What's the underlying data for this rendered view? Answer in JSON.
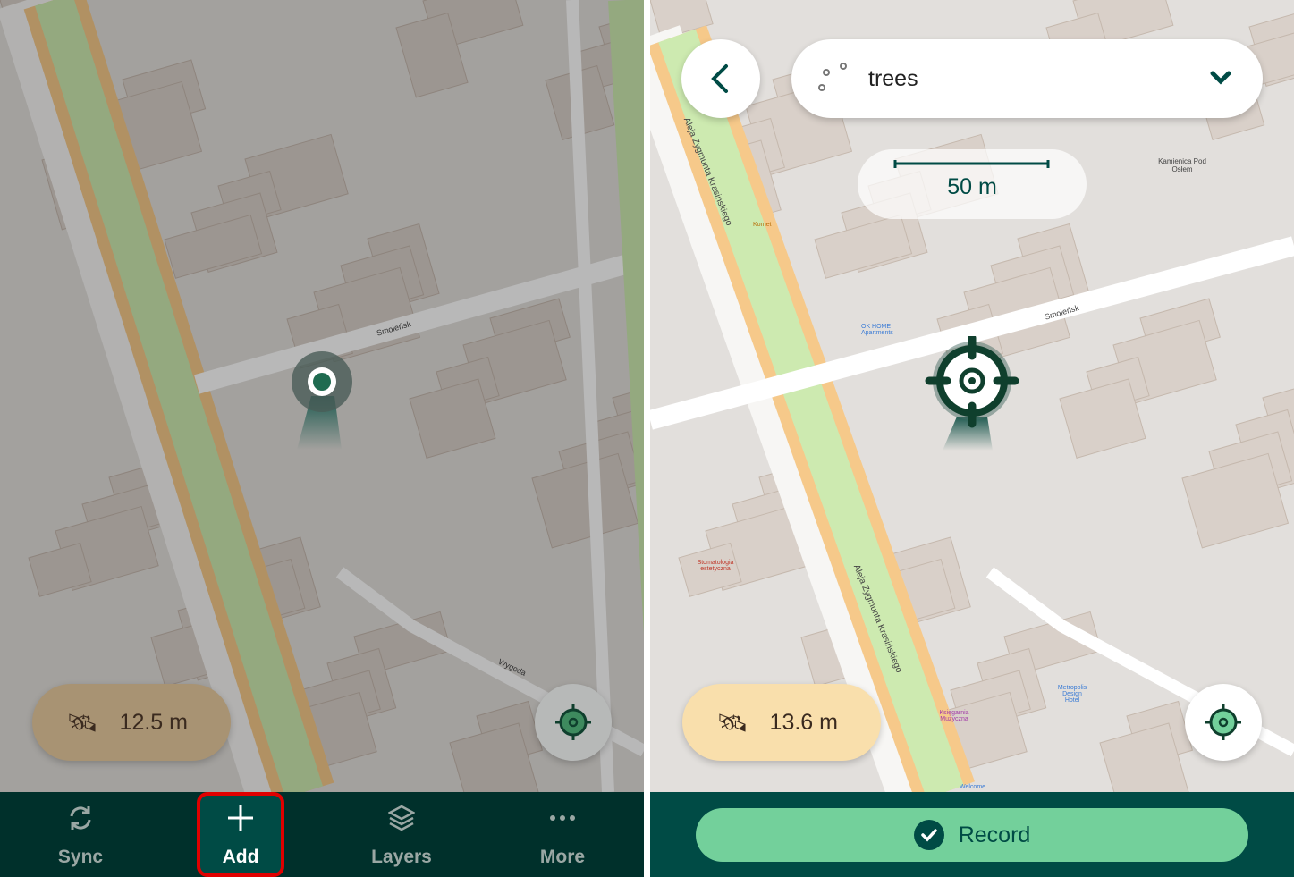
{
  "left": {
    "gps_accuracy": "12.5 m",
    "nav": [
      {
        "label": "Sync",
        "icon": "sync-icon"
      },
      {
        "label": "Add",
        "icon": "plus-icon",
        "highlighted": true
      },
      {
        "label": "Layers",
        "icon": "layers-icon"
      },
      {
        "label": "More",
        "icon": "more-icon"
      }
    ]
  },
  "right": {
    "layer_selector": {
      "value": "trees",
      "icon": "point-layer-icon"
    },
    "scale_bar": "50 m",
    "gps_accuracy": "13.6 m",
    "record_label": "Record"
  },
  "map_labels": {
    "street_smolensk": "Smoleńsk",
    "avenue": "Aleja Zygmunta Krasińskiego",
    "wygoda": "Wygoda",
    "kamienica": "Kamienica Pod Osłem",
    "ok_home": "OK HOME Apartments",
    "stomatologia": "Stomatologia estetyczna",
    "ksiegarnia": "Księgarnia Muzyczna",
    "metropolis": "Metropolis Design Hotel",
    "welcome": "Welcome",
    "kornet": "Kornet"
  },
  "colors": {
    "dark_bar": "#00302b",
    "record_bar": "#004b45",
    "record_button": "#73d09b",
    "gps_pill": "#f9dfac",
    "accent_green": "#5fb88a",
    "highlight_border": "#e00000"
  }
}
